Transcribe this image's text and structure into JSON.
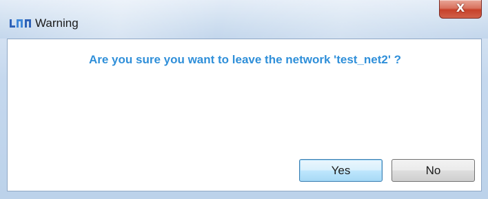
{
  "window": {
    "title": "Warning",
    "app_icon": "app-logo-icon",
    "close_glyph": "X",
    "close_icon": "close-icon"
  },
  "dialog": {
    "message": "Are you sure you want to leave the network 'test_net2' ?",
    "buttons": {
      "yes_label": "Yes",
      "no_label": "No"
    }
  },
  "colors": {
    "message_text": "#2f8fd9",
    "close_button": "#c7412a",
    "default_button_border": "#3c7fb1"
  }
}
